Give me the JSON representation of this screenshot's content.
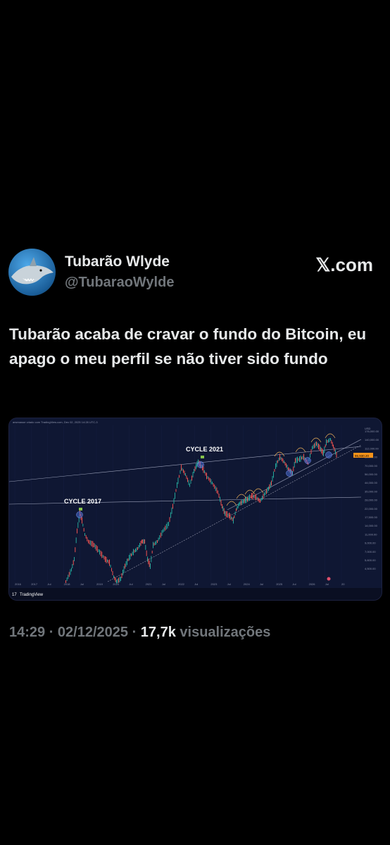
{
  "author": {
    "name": "Tubarão Wlyde",
    "handle": "@TubaraoWylde",
    "avatar_icon": "shark-avatar-icon"
  },
  "brand": "𝕏.com",
  "tweet": {
    "text": "Tubarão acaba de cravar o fundo do Bitcoin, eu apago o meu perfil se não tiver sido fundo"
  },
  "chart_data": {
    "type": "line",
    "source_label": "TradingView",
    "header_text": "arsenasse criado com TradingView.com, Dec 02, 2025 14:28 UTC-3",
    "currency": "USD",
    "annotations": [
      "CYCLE 2017",
      "CYCLE 2021"
    ],
    "current_price_label": "86,930.20",
    "x_ticks": [
      "2016",
      "2017",
      "Jul",
      "2018",
      "Jul",
      "2019",
      "2020",
      "Jul",
      "2021",
      "Jul",
      "2022",
      "Jul",
      "2023",
      "Jul",
      "2024",
      "Jul",
      "2025",
      "Jul",
      "2026",
      "Jul",
      "20"
    ],
    "y_ticks": [
      "176,000.00",
      "140,000.00",
      "112,000.00",
      "88,000.00",
      "70,000.00",
      "56,000.00",
      "44,000.00",
      "35,000.00",
      "28,000.00",
      "22,000.00",
      "17,500.00",
      "14,000.00",
      "11,000.00",
      "9,000.00",
      "7,000.00",
      "5,600.00",
      "4,500.00"
    ],
    "yscale": "log",
    "colors": {
      "candles_up": "#26a69a",
      "candles_down": "#ef5350",
      "background": "#0f1733"
    }
  },
  "meta": {
    "time": "14:29 · 02/12/2025 · ",
    "views_count": "17,7k",
    "views_label": " visualizações"
  }
}
